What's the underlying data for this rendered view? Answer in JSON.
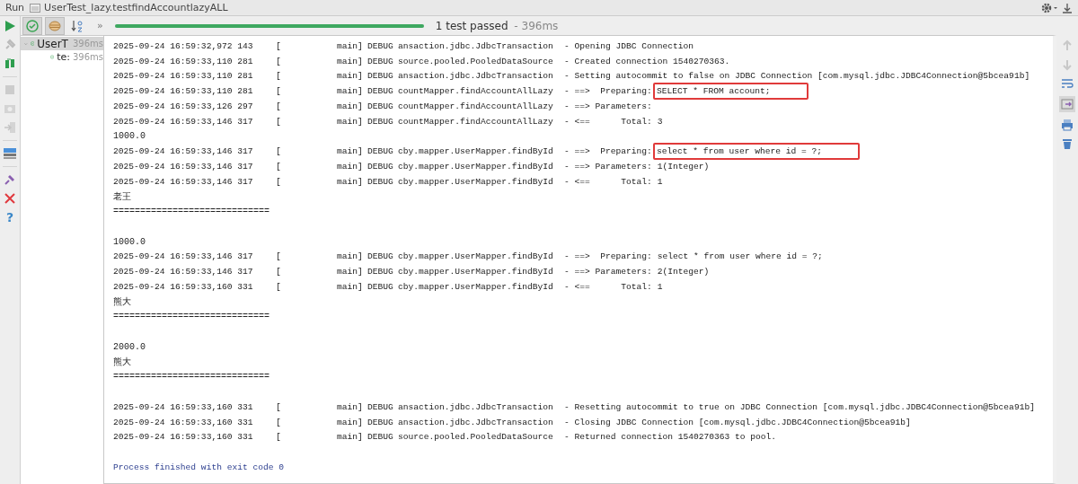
{
  "side_toolbar": {
    "help": "?"
  },
  "header": {
    "label": "Run",
    "title": "UserTest_lazy.testfindAccountlazyALL"
  },
  "toolbar": {
    "toggles": [
      {
        "kind": "check",
        "selected": true
      },
      {
        "kind": "ignored",
        "selected": true
      },
      {
        "kind": "sort",
        "selected": false
      }
    ],
    "more": "»",
    "progress": {
      "level": 1
    },
    "status": "1 test passed",
    "duration": " - 396ms"
  },
  "tree": [
    {
      "label": "UserT",
      "time": "396ms",
      "expanded": true,
      "children": [
        {
          "label": "te:",
          "time": "396ms"
        }
      ]
    }
  ],
  "console": [
    {
      "kind": "log",
      "ts": "2025-09-24 16:59:32,972 143",
      "bracket": "[",
      "thread": "main]",
      "level": "DEBUG",
      "logger": "ansaction.jdbc.JdbcTransaction",
      "message": "- Opening JDBC Connection"
    },
    {
      "kind": "log",
      "ts": "2025-09-24 16:59:33,110 281",
      "bracket": "[",
      "thread": "main]",
      "level": "DEBUG",
      "logger": "source.pooled.PooledDataSource",
      "message": "- Created connection 1540270363."
    },
    {
      "kind": "log",
      "ts": "2025-09-24 16:59:33,110 281",
      "bracket": "[",
      "thread": "main]",
      "level": "DEBUG",
      "logger": "ansaction.jdbc.JdbcTransaction",
      "message": "- Setting autocommit to false on JDBC Connection [com.mysql.jdbc.JDBC4Connection@5bcea91b]"
    },
    {
      "kind": "log",
      "ts": "2025-09-24 16:59:33,110 281",
      "bracket": "[",
      "thread": "main]",
      "level": "DEBUG",
      "logger": "countMapper.findAccountAllLazy",
      "message": "- ==>  Preparing:",
      "highlight": "SELECT * FROM account;"
    },
    {
      "kind": "log",
      "ts": "2025-09-24 16:59:33,126 297",
      "bracket": "[",
      "thread": "main]",
      "level": "DEBUG",
      "logger": "countMapper.findAccountAllLazy",
      "message": "- ==> Parameters:"
    },
    {
      "kind": "log",
      "ts": "2025-09-24 16:59:33,146 317",
      "bracket": "[",
      "thread": "main]",
      "level": "DEBUG",
      "logger": "countMapper.findAccountAllLazy",
      "message": "- <==      Total: 3"
    },
    {
      "kind": "text",
      "text": "1000.0"
    },
    {
      "kind": "log",
      "ts": "2025-09-24 16:59:33,146 317",
      "bracket": "[",
      "thread": "main]",
      "level": "DEBUG",
      "logger": "cby.mapper.UserMapper.findById",
      "message": "- ==>  Preparing:",
      "highlight": "select * from user where id = ?;"
    },
    {
      "kind": "log",
      "ts": "2025-09-24 16:59:33,146 317",
      "bracket": "[",
      "thread": "main]",
      "level": "DEBUG",
      "logger": "cby.mapper.UserMapper.findById",
      "message": "- ==> Parameters: 1(Integer)"
    },
    {
      "kind": "log",
      "ts": "2025-09-24 16:59:33,146 317",
      "bracket": "[",
      "thread": "main]",
      "level": "DEBUG",
      "logger": "cby.mapper.UserMapper.findById",
      "message": "- <==      Total: 1"
    },
    {
      "kind": "text",
      "text": "老王"
    },
    {
      "kind": "text",
      "text": "============================="
    },
    {
      "kind": "blank"
    },
    {
      "kind": "text",
      "text": "1000.0"
    },
    {
      "kind": "log",
      "ts": "2025-09-24 16:59:33,146 317",
      "bracket": "[",
      "thread": "main]",
      "level": "DEBUG",
      "logger": "cby.mapper.UserMapper.findById",
      "message": "- ==>  Preparing: select * from user where id = ?;"
    },
    {
      "kind": "log",
      "ts": "2025-09-24 16:59:33,146 317",
      "bracket": "[",
      "thread": "main]",
      "level": "DEBUG",
      "logger": "cby.mapper.UserMapper.findById",
      "message": "- ==> Parameters: 2(Integer)"
    },
    {
      "kind": "log",
      "ts": "2025-09-24 16:59:33,160 331",
      "bracket": "[",
      "thread": "main]",
      "level": "DEBUG",
      "logger": "cby.mapper.UserMapper.findById",
      "message": "- <==      Total: 1"
    },
    {
      "kind": "text",
      "text": "熊大"
    },
    {
      "kind": "text",
      "text": "============================="
    },
    {
      "kind": "blank"
    },
    {
      "kind": "text",
      "text": "2000.0"
    },
    {
      "kind": "text",
      "text": "熊大"
    },
    {
      "kind": "text",
      "text": "============================="
    },
    {
      "kind": "blank"
    },
    {
      "kind": "log",
      "ts": "2025-09-24 16:59:33,160 331",
      "bracket": "[",
      "thread": "main]",
      "level": "DEBUG",
      "logger": "ansaction.jdbc.JdbcTransaction",
      "message": "- Resetting autocommit to true on JDBC Connection [com.mysql.jdbc.JDBC4Connection@5bcea91b]"
    },
    {
      "kind": "log",
      "ts": "2025-09-24 16:59:33,160 331",
      "bracket": "[",
      "thread": "main]",
      "level": "DEBUG",
      "logger": "ansaction.jdbc.JdbcTransaction",
      "message": "- Closing JDBC Connection [com.mysql.jdbc.JDBC4Connection@5bcea91b]"
    },
    {
      "kind": "log",
      "ts": "2025-09-24 16:59:33,160 331",
      "bracket": "[",
      "thread": "main]",
      "level": "DEBUG",
      "logger": "source.pooled.PooledDataSource",
      "message": "- Returned connection 1540270363 to pool."
    },
    {
      "kind": "blank"
    },
    {
      "kind": "exit",
      "text": "Process finished with exit code 0"
    }
  ]
}
